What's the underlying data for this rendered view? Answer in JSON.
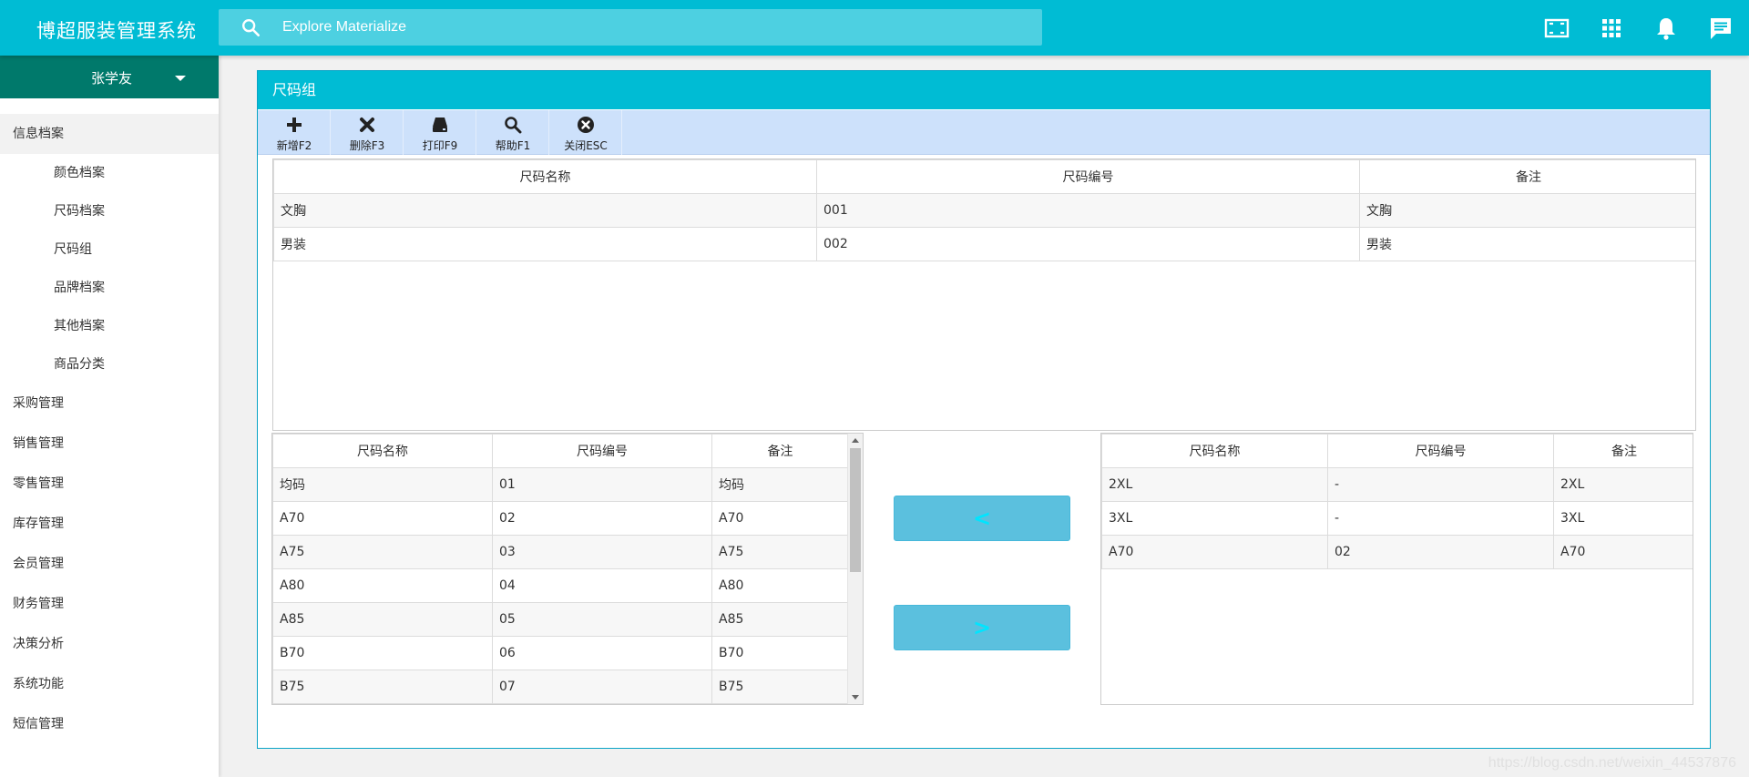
{
  "app": {
    "title": "博超服装管理系统",
    "search_placeholder": "Explore Materialize",
    "user": "张学友"
  },
  "sidebar": {
    "sections": [
      {
        "label": "信息档案",
        "active": true,
        "children": [
          "颜色档案",
          "尺码档案",
          "尺码组",
          "品牌档案",
          "其他档案",
          "商品分类"
        ]
      },
      {
        "label": "采购管理"
      },
      {
        "label": "销售管理"
      },
      {
        "label": "零售管理"
      },
      {
        "label": "库存管理"
      },
      {
        "label": "会员管理"
      },
      {
        "label": "财务管理"
      },
      {
        "label": "决策分析"
      },
      {
        "label": "系统功能"
      },
      {
        "label": "短信管理"
      }
    ]
  },
  "panel": {
    "title": "尺码组",
    "toolbar": {
      "add": "新增F2",
      "delete": "删除F3",
      "print": "打印F9",
      "help": "帮助F1",
      "close": "关闭ESC"
    }
  },
  "groups_table": {
    "headers": [
      "尺码名称",
      "尺码编号",
      "备注"
    ],
    "rows": [
      [
        "文胸",
        "001",
        "文胸"
      ],
      [
        "男装",
        "002",
        "男装"
      ]
    ]
  },
  "available_table": {
    "headers": [
      "尺码名称",
      "尺码编号",
      "备注"
    ],
    "rows": [
      [
        "均码",
        "01",
        "均码"
      ],
      [
        "A70",
        "02",
        "A70"
      ],
      [
        "A75",
        "03",
        "A75"
      ],
      [
        "A80",
        "04",
        "A80"
      ],
      [
        "A85",
        "05",
        "A85"
      ],
      [
        "B70",
        "06",
        "B70"
      ],
      [
        "B75",
        "07",
        "B75"
      ]
    ]
  },
  "move_buttons": {
    "left": "<",
    "right": ">"
  },
  "selected_table": {
    "headers": [
      "尺码名称",
      "尺码编号",
      "备注"
    ],
    "rows": [
      [
        "2XL",
        "-",
        "2XL"
      ],
      [
        "3XL",
        "-",
        "3XL"
      ],
      [
        "A70",
        "02",
        "A70"
      ]
    ]
  },
  "watermark": "https://blog.csdn.net/weixin_44537876",
  "colors": {
    "primary": "#00bcd4",
    "search_bg": "#4dd0e1",
    "user_bar": "#00796b",
    "toolbar_bg": "#cde1fb",
    "move_button": "#5bc0de"
  }
}
